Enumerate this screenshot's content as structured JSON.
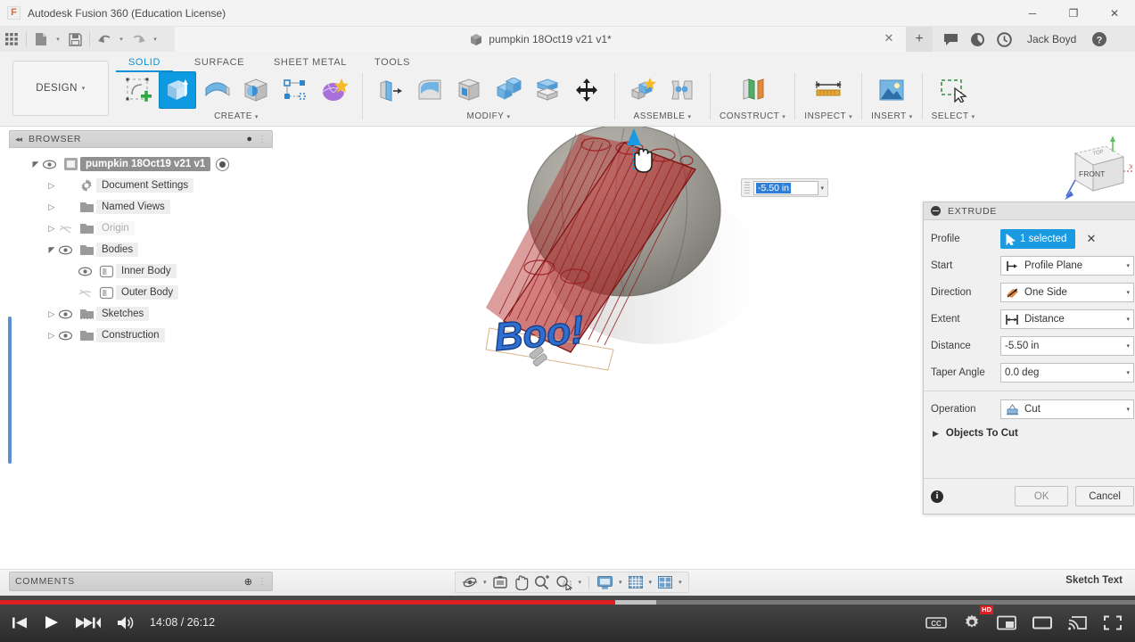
{
  "window": {
    "title": "Autodesk Fusion 360 (Education License)",
    "app_icon": "F",
    "minimize_label": "─",
    "maximize_label": "❐",
    "close_label": "✕"
  },
  "quick_access": {
    "items": [
      {
        "name": "grid-apps-icon",
        "label": "apps-grid"
      },
      {
        "name": "new-document-icon",
        "label": "new-document",
        "caret": true
      },
      {
        "name": "save-icon",
        "label": "save"
      },
      {
        "name": "undo-icon",
        "label": "undo",
        "caret": true
      },
      {
        "name": "redo-icon",
        "label": "redo",
        "caret": true
      }
    ]
  },
  "tabs": {
    "document_tab": {
      "label": "pumpkin 18Oct19 v21 v1*",
      "close_label": "✕"
    },
    "new_tab_label": "+",
    "right_icons": [
      "comment-icon",
      "job-status-icon",
      "recent-icon",
      "help-icon"
    ],
    "user_name": "Jack Boyd"
  },
  "ribbon": {
    "design_button": "DESIGN",
    "caret": "▾",
    "tabs": [
      {
        "label": "SOLID",
        "active": true
      },
      {
        "label": "SURFACE",
        "active": false
      },
      {
        "label": "SHEET METAL",
        "active": false
      },
      {
        "label": "TOOLS",
        "active": false
      }
    ],
    "groups": [
      {
        "label": "CREATE",
        "has_caret": true,
        "tools": [
          "create-sketch-icon",
          "extrude-icon",
          "revolve-icon",
          "sweep-icon",
          "loft-icon",
          "pattern-icon",
          "form-icon"
        ]
      },
      {
        "label": "MODIFY",
        "has_caret": true,
        "tools": [
          "press-pull-icon",
          "fillet-icon",
          "shell-icon",
          "combine-icon",
          "split-body-icon",
          "move-copy-icon"
        ]
      },
      {
        "label": "ASSEMBLE",
        "has_caret": true,
        "tools": [
          "new-component-icon",
          "joint-icon"
        ]
      },
      {
        "label": "CONSTRUCT",
        "has_caret": true,
        "tools": [
          "offset-plane-icon"
        ]
      },
      {
        "label": "INSPECT",
        "has_caret": true,
        "tools": [
          "measure-icon"
        ]
      },
      {
        "label": "INSERT",
        "has_caret": true,
        "tools": [
          "insert-image-icon"
        ]
      },
      {
        "label": "SELECT",
        "has_caret": true,
        "tools": [
          "select-window-icon"
        ]
      }
    ]
  },
  "browser": {
    "header": {
      "title": "BROWSER",
      "collapse_arrows": "◂◂",
      "dot_label": "●"
    },
    "nodes": [
      {
        "label": "pumpkin 18Oct19 v21 v1",
        "twisty": "expanded",
        "eye": "visible",
        "icon": "component-icon",
        "indent": 0,
        "root": true,
        "radio": true
      },
      {
        "label": "Document Settings",
        "twisty": "collapsed",
        "eye": "none",
        "icon": "gear-icon",
        "indent": 1
      },
      {
        "label": "Named Views",
        "twisty": "collapsed",
        "eye": "none",
        "icon": "folder-icon",
        "indent": 1
      },
      {
        "label": "Origin",
        "twisty": "collapsed",
        "eye": "hidden",
        "icon": "folder-icon",
        "indent": 1
      },
      {
        "label": "Bodies",
        "twisty": "expanded",
        "eye": "visible",
        "icon": "folder-icon",
        "indent": 1
      },
      {
        "label": "Inner Body",
        "twisty": "none",
        "eye": "visible",
        "icon": "body-icon",
        "indent": 2
      },
      {
        "label": "Outer Body",
        "twisty": "none",
        "eye": "hidden",
        "icon": "body-icon",
        "indent": 2
      },
      {
        "label": "Sketches",
        "twisty": "collapsed",
        "eye": "visible",
        "icon": "sketch-folder-icon",
        "indent": 1
      },
      {
        "label": "Construction",
        "twisty": "collapsed",
        "eye": "visible",
        "icon": "folder-icon",
        "indent": 1
      }
    ]
  },
  "canvas": {
    "sketch_text": "Boo!",
    "manipulator_value": "-5.50 in",
    "viewcube_front_label": "FRONT",
    "viewcube_top_label": "TOP",
    "axis_x_label": "X",
    "axis_colors": {
      "x": "#d95656",
      "y": "#5fbf5f",
      "z": "#4a6ed6"
    },
    "model_color": "#c02b2b",
    "arrow_color": "#1a9ae0"
  },
  "extrude_dialog": {
    "title": "EXTRUDE",
    "rows": [
      {
        "label": "Profile",
        "type": "selection",
        "value": "1 selected",
        "icon": "cursor-arrow-icon",
        "clear_label": "✕"
      },
      {
        "label": "Start",
        "type": "combo",
        "value": "Profile Plane",
        "icon": "profile-plane-icon"
      },
      {
        "label": "Direction",
        "type": "combo",
        "value": "One Side",
        "icon": "one-side-icon"
      },
      {
        "label": "Extent",
        "type": "combo",
        "value": "Distance",
        "icon": "distance-icon"
      },
      {
        "label": "Distance",
        "type": "field",
        "value": "-5.50 in"
      },
      {
        "label": "Taper Angle",
        "type": "field",
        "value": "0.0 deg"
      },
      {
        "label": "Operation",
        "type": "combo",
        "value": "Cut",
        "icon": "cut-icon"
      }
    ],
    "expander_label": "Objects To Cut",
    "expander_twisty": "▶",
    "ok_label": "OK",
    "cancel_label": "Cancel",
    "info_label": "i",
    "caret": "▾"
  },
  "comments": {
    "title": "COMMENTS",
    "dot_label": "⊕"
  },
  "navigation_bar": {
    "items": [
      {
        "name": "orbit-icon",
        "caret": true
      },
      {
        "name": "look-at-icon",
        "caret": false
      },
      {
        "name": "pan-icon",
        "caret": false
      },
      {
        "name": "zoom-icon",
        "caret": false
      },
      {
        "name": "zoom-window-icon",
        "caret": true
      },
      {
        "name": "display-settings-icon",
        "caret": true
      },
      {
        "name": "grid-snaps-icon",
        "caret": true
      },
      {
        "name": "viewports-icon",
        "caret": true
      }
    ]
  },
  "status_bar": {
    "right_label": "Sketch Text"
  },
  "player": {
    "current_time": "14:08",
    "duration": "26:12",
    "time_separator": "/",
    "played_percent": 54.2,
    "buffered_percent": 57.8,
    "progress_color": "#e02020",
    "left_controls": [
      {
        "name": "previous-video-button"
      },
      {
        "name": "play-button"
      },
      {
        "name": "next-video-button"
      },
      {
        "name": "volume-button"
      }
    ],
    "right_controls": [
      {
        "name": "captions-button",
        "label": "CC"
      },
      {
        "name": "settings-gear-button",
        "badge": "HD"
      },
      {
        "name": "miniplayer-button"
      },
      {
        "name": "theater-mode-button"
      },
      {
        "name": "cast-button"
      },
      {
        "name": "fullscreen-button"
      }
    ]
  }
}
